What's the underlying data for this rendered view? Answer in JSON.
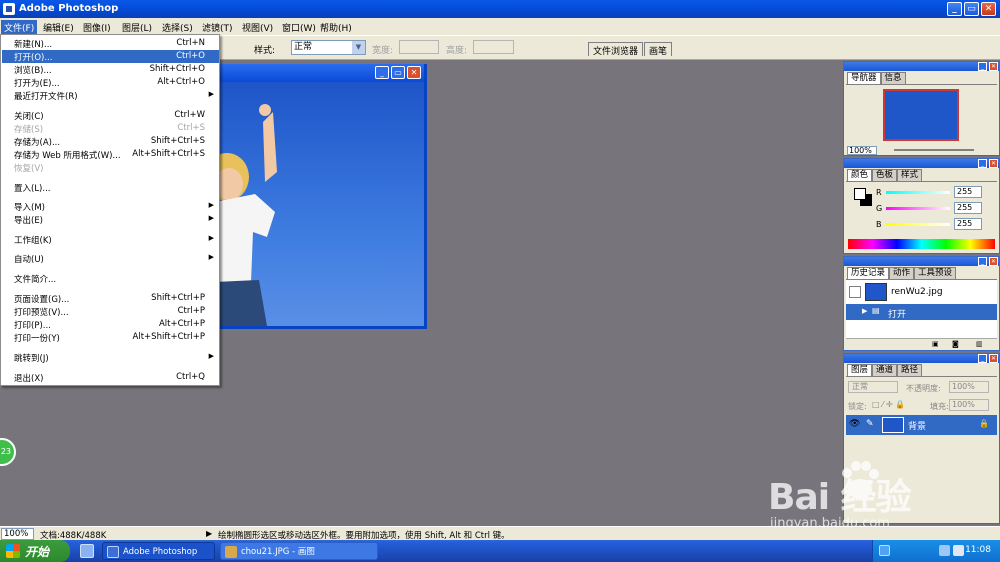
{
  "window": {
    "title": "Adobe Photoshop"
  },
  "menubar": {
    "items": [
      "文件(F)",
      "编辑(E)",
      "图像(I)",
      "图层(L)",
      "选择(S)",
      "滤镜(T)",
      "视图(V)",
      "窗口(W)",
      "帮助(H)"
    ]
  },
  "options": {
    "style_label": "样式:",
    "style_value": "正常",
    "width_label": "宽度:",
    "height_label": "高度:",
    "well_tabs": [
      "文件浏览器",
      "画笔"
    ]
  },
  "file_menu": {
    "items": [
      {
        "label": "新建(N)...",
        "shortcut": "Ctrl+N"
      },
      {
        "label": "打开(O)...",
        "shortcut": "Ctrl+O"
      },
      {
        "label": "浏览(B)...",
        "shortcut": "Shift+Ctrl+O"
      },
      {
        "label": "打开为(E)...",
        "shortcut": "Alt+Ctrl+O"
      },
      {
        "label": "最近打开文件(R)",
        "shortcut": ""
      },
      {
        "label": "关闭(C)",
        "shortcut": "Ctrl+W"
      },
      {
        "label": "存储(S)",
        "shortcut": "Ctrl+S"
      },
      {
        "label": "存储为(A)...",
        "shortcut": "Shift+Ctrl+S"
      },
      {
        "label": "存储为 Web 所用格式(W)...",
        "shortcut": "Alt+Shift+Ctrl+S"
      },
      {
        "label": "恢复(V)",
        "shortcut": ""
      },
      {
        "label": "置入(L)...",
        "shortcut": ""
      },
      {
        "label": "导入(M)",
        "shortcut": ""
      },
      {
        "label": "导出(E)",
        "shortcut": ""
      },
      {
        "label": "工作组(K)",
        "shortcut": ""
      },
      {
        "label": "自动(U)",
        "shortcut": ""
      },
      {
        "label": "文件简介...",
        "shortcut": ""
      },
      {
        "label": "页面设置(G)...",
        "shortcut": "Shift+Ctrl+P"
      },
      {
        "label": "打印预览(V)...",
        "shortcut": "Ctrl+P"
      },
      {
        "label": "打印(P)...",
        "shortcut": "Alt+Ctrl+P"
      },
      {
        "label": "打印一份(Y)",
        "shortcut": "Alt+Shift+Ctrl+P"
      },
      {
        "label": "跳转到(J)",
        "shortcut": ""
      },
      {
        "label": "退出(X)",
        "shortcut": "Ctrl+Q"
      }
    ]
  },
  "navigator": {
    "tabs": [
      "导航器",
      "信息"
    ],
    "zoom": "100%"
  },
  "color": {
    "tabs": [
      "颜色",
      "色板",
      "样式"
    ],
    "r_label": "R",
    "g_label": "G",
    "b_label": "B",
    "r": "255",
    "g": "255",
    "b": "255"
  },
  "history": {
    "tabs": [
      "历史记录",
      "动作",
      "工具预设"
    ],
    "snapshot": "renWu2.jpg",
    "step": "打开"
  },
  "layers": {
    "tabs": [
      "图层",
      "通道",
      "路径"
    ],
    "blend": "正常",
    "opacity_label": "不透明度:",
    "opacity": "100%",
    "lock_label": "锁定:",
    "fill_label": "填充:",
    "fill": "100%",
    "layer_name": "背景"
  },
  "status": {
    "zoom": "100%",
    "doc": "文档:488K/488K",
    "hint": "绘制椭圆形选区或移动选区外框。要用附加选项，使用 Shift, Alt 和 Ctrl 键。"
  },
  "taskbar": {
    "start": "开始",
    "tasks": [
      "Adobe Photoshop",
      "chou21.JPG - 画图"
    ],
    "clock": "11:08"
  },
  "watermark": {
    "brand": "Bai  经验",
    "url": "jingyan.baidu.com"
  },
  "side_badge": "23"
}
